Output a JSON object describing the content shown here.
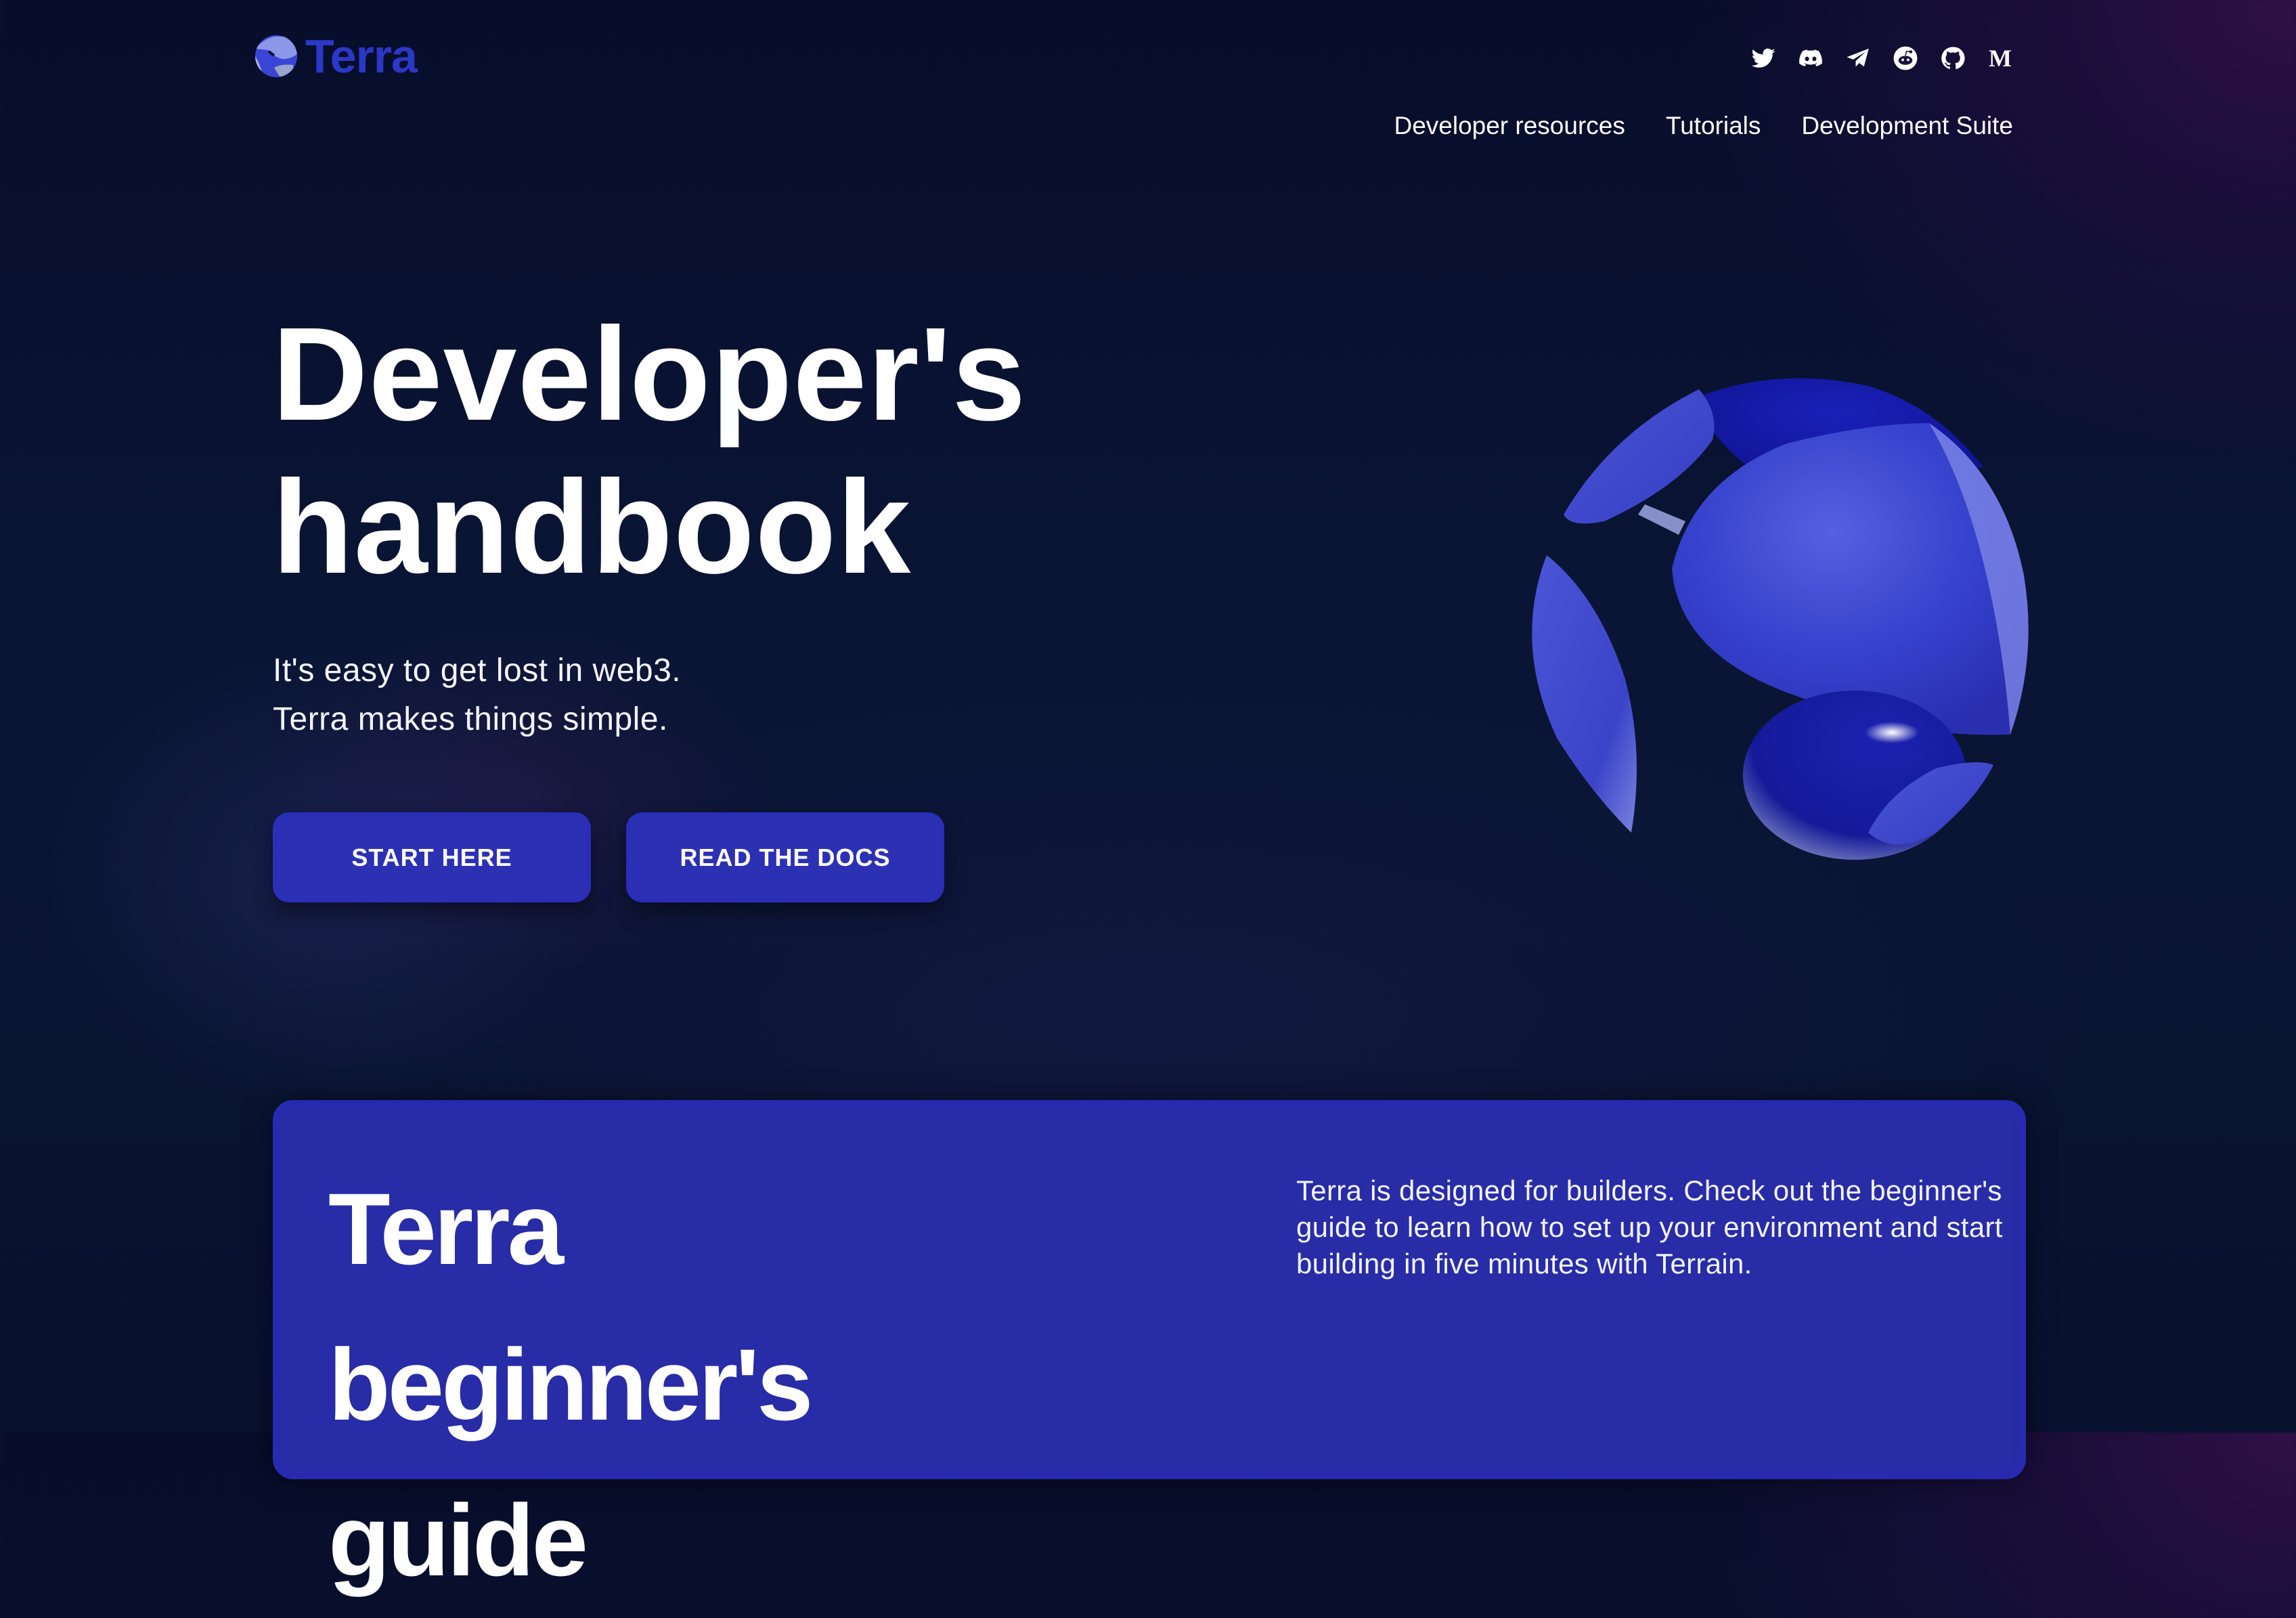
{
  "header": {
    "logo_text": "Terra",
    "brand_color": "#2b37c6",
    "social_icons": [
      {
        "name": "twitter-icon",
        "label": "Twitter"
      },
      {
        "name": "discord-icon",
        "label": "Discord"
      },
      {
        "name": "telegram-icon",
        "label": "Telegram"
      },
      {
        "name": "reddit-icon",
        "label": "Reddit"
      },
      {
        "name": "github-icon",
        "label": "GitHub"
      },
      {
        "name": "medium-icon",
        "label": "M"
      }
    ],
    "nav": [
      {
        "label": "Developer resources"
      },
      {
        "label": "Tutorials"
      },
      {
        "label": "Development Suite"
      }
    ]
  },
  "hero": {
    "title_line1": "Developer's",
    "title_line2": "handbook",
    "subtitle_line1": "It's easy to get lost in web3.",
    "subtitle_line2": "Terra makes things simple.",
    "buttons": {
      "start": "START HERE",
      "docs": "READ THE DOCS"
    },
    "button_color": "#2c31b4"
  },
  "card": {
    "title_line1": "Terra",
    "title_line2": "beginner's",
    "title_line3": "guide",
    "description": "Terra is designed for builders. Check out the beginner's guide to learn how to set up your environment and start building in five minutes with Terrain.",
    "color": "#282ca6"
  }
}
